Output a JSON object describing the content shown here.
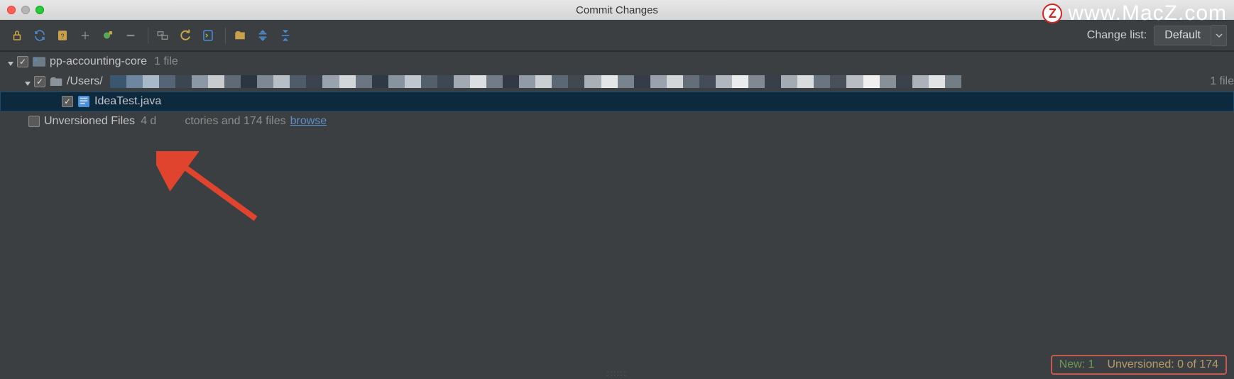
{
  "title": "Commit Changes",
  "watermark": "www.MacZ.com",
  "changeList": {
    "label": "Change list:",
    "selected": "Default"
  },
  "tree": {
    "root": {
      "name": "pp-accounting-core",
      "count": "1 file"
    },
    "pathRow": {
      "prefix": "/Users/",
      "count": "1 file"
    },
    "fileRow": {
      "name": "IdeaTest.java"
    },
    "unversioned": {
      "label": "Unversioned Files",
      "detailPrefix": "4 d",
      "detailSuffix": "ctories and 174 files",
      "link": "browse"
    }
  },
  "status": {
    "newLabel": "New: 1",
    "unvLabel": "Unversioned: 0 of 174"
  },
  "pixelColors": [
    "#3b5770",
    "#6e86a0",
    "#a7b9c9",
    "#556575",
    "#3b4651",
    "#8b97a3",
    "#c8cccf",
    "#606a75",
    "#2b3641",
    "#7d8893",
    "#b7bfc6",
    "#4e5b69",
    "#3a434e",
    "#99a3ad",
    "#d3d6d9",
    "#6c7682",
    "#2f3944",
    "#8893a0",
    "#c0c6cd",
    "#535f6b",
    "#3d4852",
    "#a1aab3",
    "#dcdfe1",
    "#727c87",
    "#313a44",
    "#919ba6",
    "#cacfd4",
    "#5b6773",
    "#40494f",
    "#a8b0b8",
    "#e3e5e7",
    "#79838d",
    "#343d47",
    "#9aa3ad",
    "#d2d6d9",
    "#636e79",
    "#444d57",
    "#b0b7be",
    "#eaebec",
    "#808992",
    "#374049",
    "#a3abb3",
    "#d9dcde",
    "#6b7580",
    "#48515a",
    "#b7bdc3",
    "#efeff0",
    "#878f97",
    "#3a434c",
    "#abb2b9",
    "#e0e2e4",
    "#737d86"
  ]
}
